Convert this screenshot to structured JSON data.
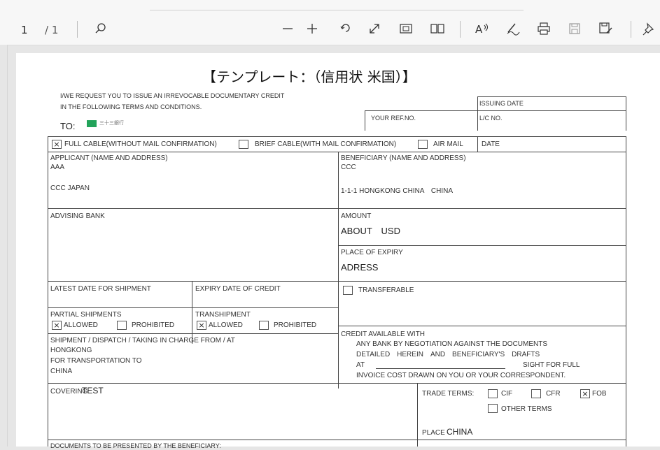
{
  "toolbar": {
    "page_current": "1",
    "page_total": "/ 1"
  },
  "form": {
    "title": "【テンプレート：（信用状 米国）】",
    "intro_line1": "I/WE REQUEST YOU TO ISSUE AN IRREVOCABLE DOCUMENTARY CREDIT",
    "intro_line2": "IN THE FOLLOWING TERMS AND CONDITIONS.",
    "to_label": "TO:",
    "bank_logo_text": "三十三銀行",
    "issuing_date": "ISSUING DATE",
    "your_ref_no": "YOUR REF.NO.",
    "lc_no": "L/C NO.",
    "full_cable": "FULL CABLE(WITHOUT MAIL CONFIRMATION)",
    "brief_cable": "BRIEF CABLE(WITH MAIL CONFIRMATION)",
    "air_mail": "AIR MAIL",
    "date": "DATE",
    "applicant_label": "APPLICANT (NAME AND ADDRESS)",
    "applicant_name": "AAA",
    "applicant_addr": "CCC JAPAN",
    "beneficiary_label": "BENEFICIARY (NAME AND ADDRESS)",
    "beneficiary_name": "CCC",
    "beneficiary_addr": "1-1-1 HONGKONG CHINA　CHINA",
    "advising_bank": "ADVISING BANK",
    "amount_label": "AMOUNT",
    "amount_value": "ABOUT　USD",
    "place_expiry_label": "PLACE OF EXPIRY",
    "place_expiry_value": "ADRESS",
    "latest_date": "LATEST DATE FOR SHIPMENT",
    "expiry_date": "EXPIRY DATE OF CREDIT",
    "transferable": "TRANSFERABLE",
    "partial_shipments": "PARTIAL SHIPMENTS",
    "transhipment": "TRANSHIPMENT",
    "allowed": "ALLOWED",
    "prohibited": "PROHIBITED",
    "shipment_label": "SHIPMENT / DISPATCH / TAKING IN CHARGE FROM / AT",
    "shipment_from": "HONGKONG",
    "transport_to_label": "FOR TRANSPORTATION TO",
    "transport_to": "CHINA",
    "credit_available": "CREDIT AVAILABLE WITH",
    "credit_line1": "ANY BANK BY NEGOTIATION AGAINST THE DOCUMENTS",
    "credit_line2": "DETAILED　HEREIN　AND　BENEFICIARY'S　DRAFTS",
    "credit_line3_a": "AT",
    "credit_line3_b": "SIGHT FOR FULL",
    "credit_line4": "INVOICE COST DRAWN ON YOU OR YOUR CORRESPONDENT.",
    "covering_label": "COVERING",
    "covering_value": "TEST",
    "trade_terms": "TRADE TERMS:",
    "cif": "CIF",
    "cfr": "CFR",
    "fob": "FOB",
    "other_terms": "OTHER TERMS",
    "place_label": "PLACE",
    "place_value": "CHINA",
    "documents_label": "DOCUMENTS TO BE PRESENTED BY THE BENEFICIARY:",
    "check_mark": "×"
  }
}
